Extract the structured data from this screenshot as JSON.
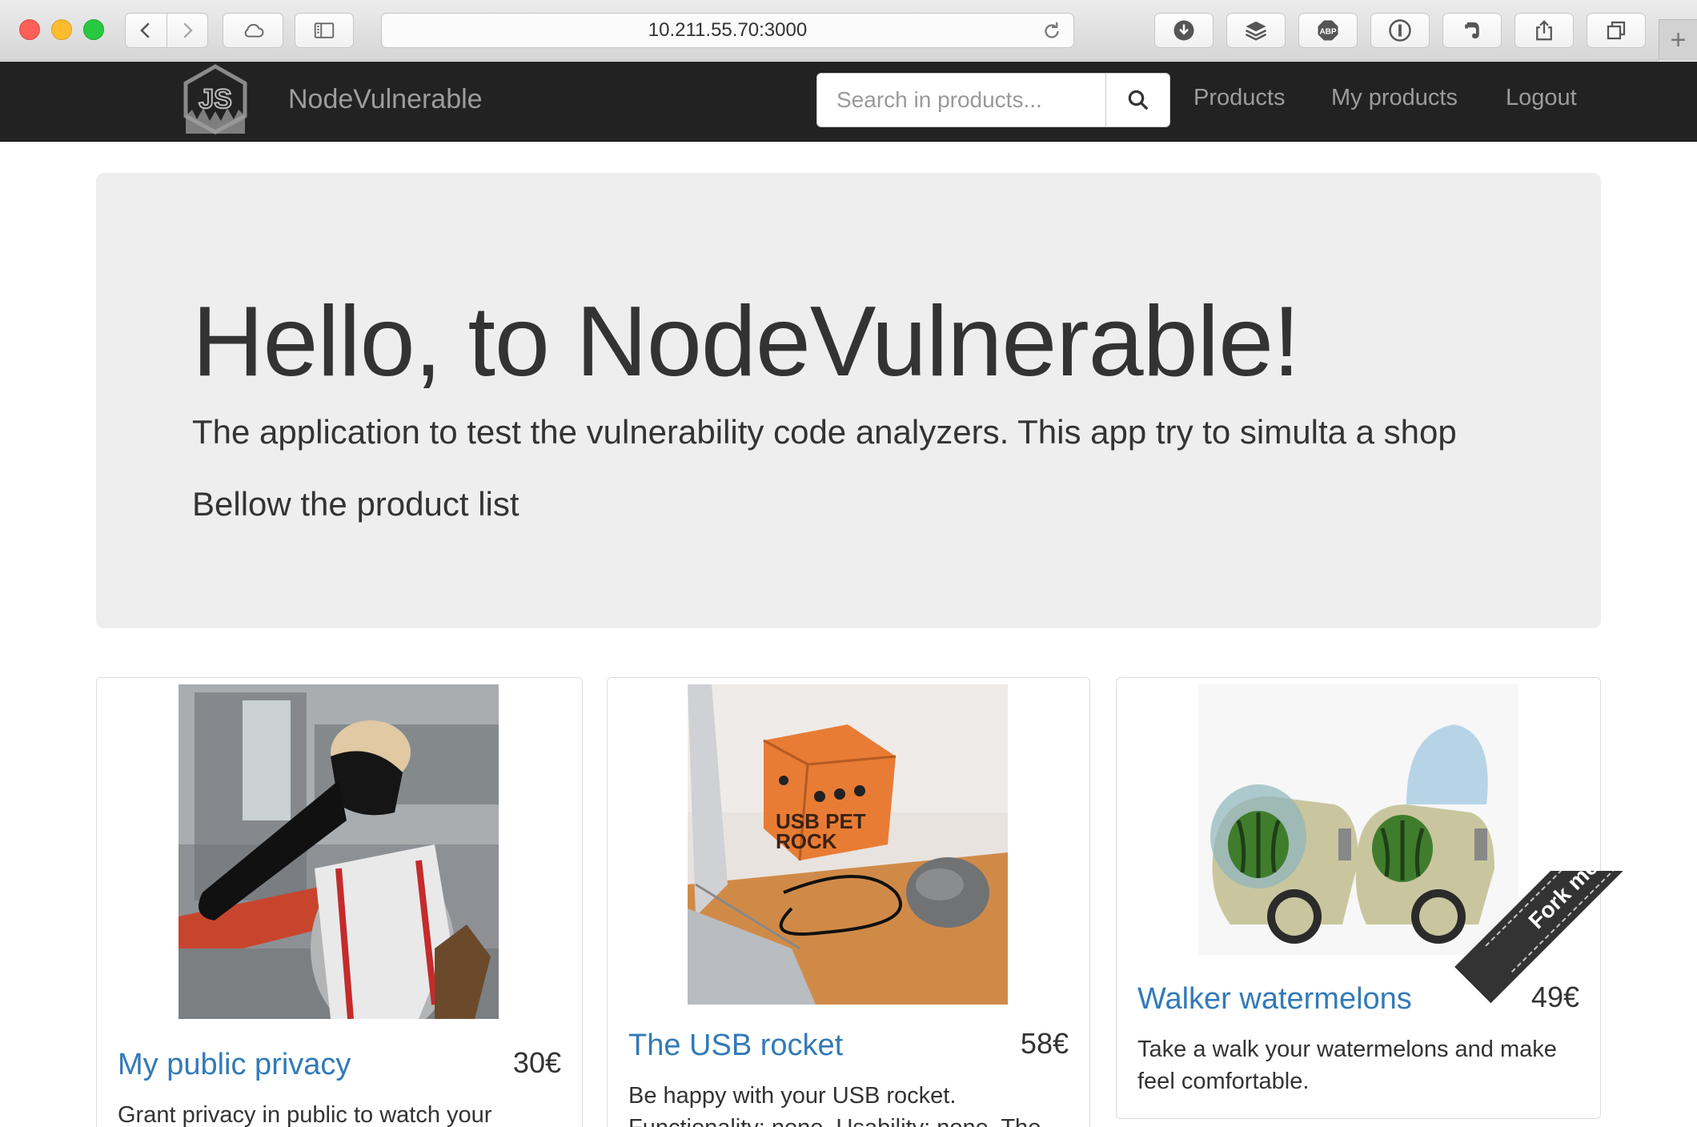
{
  "browser": {
    "url": "10.211.55.70:3000"
  },
  "navbar": {
    "brand": "NodeVulnerable",
    "search_placeholder": "Search in products...",
    "links": [
      "Products",
      "My products",
      "Logout"
    ]
  },
  "jumbotron": {
    "heading": "Hello, to NodeVulnerable!",
    "lead": "The application to test the vulnerability code analyzers. This app try to simulta a shop",
    "sub": "Bellow the product list"
  },
  "products": [
    {
      "title": "My public privacy",
      "price": "30€",
      "description": "Grant privacy in public to watch your"
    },
    {
      "title": "The USB rocket",
      "price": "58€",
      "description": "Be happy with your USB rocket.",
      "description_cut": "Functionality: none. Usability: none. The"
    },
    {
      "title": "Walker watermelons",
      "price": "49€",
      "description": "Take a walk your watermelons and make",
      "description_2": "feel comfortable."
    }
  ],
  "ribbon": {
    "text": "Fork me on GitHub"
  },
  "colors": {
    "navbar_bg": "#222222",
    "link": "#337ab7",
    "jumbotron_bg": "#eeeeee"
  }
}
